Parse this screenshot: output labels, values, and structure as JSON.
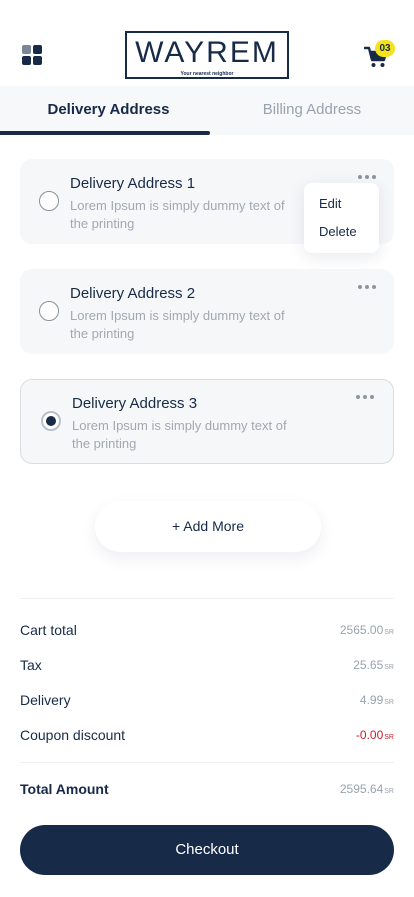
{
  "header": {
    "logo_text": "WAYREM",
    "logo_tagline": "Your nearest neighbor",
    "cart_count": "03"
  },
  "tabs": [
    {
      "label": "Delivery Address",
      "active": true
    },
    {
      "label": "Billing  Address",
      "active": false
    }
  ],
  "addresses": [
    {
      "title": "Delivery Address 1",
      "description": "Lorem Ipsum is simply dummy text of the printing",
      "selected": false
    },
    {
      "title": "Delivery Address 2",
      "description": "Lorem Ipsum is simply dummy text of the printing",
      "selected": false
    },
    {
      "title": "Delivery Address 3",
      "description": "Lorem Ipsum is simply dummy text of the printing",
      "selected": true
    }
  ],
  "context_menu": {
    "edit": "Edit",
    "delete": "Delete"
  },
  "add_more_label": "+ Add More",
  "summary": {
    "currency": "SR",
    "cart_total": {
      "label": "Cart total",
      "value": "2565.00"
    },
    "tax": {
      "label": "Tax",
      "value": "25.65"
    },
    "delivery": {
      "label": "Delivery",
      "value": "4.99"
    },
    "coupon": {
      "label": "Coupon discount",
      "value": "-0.00"
    },
    "total": {
      "label": "Total Amount",
      "value": "2595.64"
    }
  },
  "checkout_label": "Checkout",
  "colors": {
    "primary": "#172a48",
    "accent": "#f4e31c",
    "discount": "#c8202a"
  }
}
